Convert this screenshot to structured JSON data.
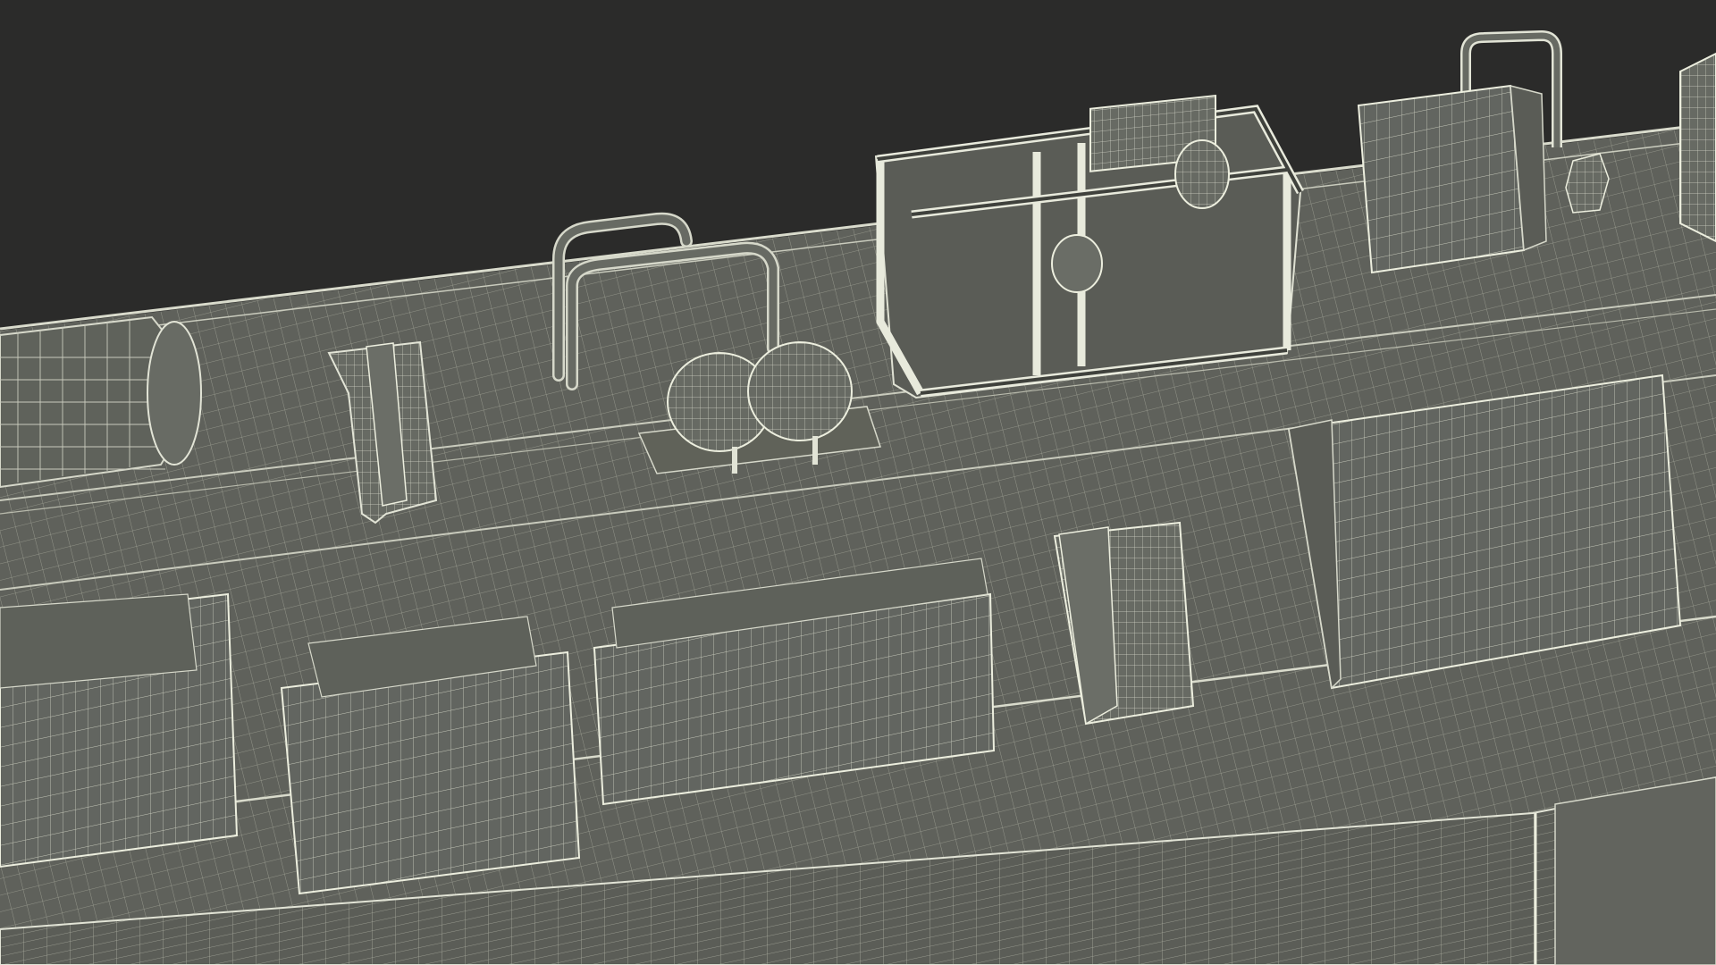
{
  "viewport": {
    "background_color": "#2b2b2a",
    "mesh_face_color": "#636560",
    "mesh_face_dark": "#55574f",
    "mesh_face_light": "#73756e",
    "wire_color": "#c9cbbd",
    "wire_highlight": "#f2f3e6"
  },
  "scene": {
    "subject": "wireframe-mesh-render",
    "objects": [
      {
        "kind": "cylindrical-tank",
        "name": "left-tank"
      },
      {
        "kind": "valve-box",
        "name": "small-valve-box"
      },
      {
        "kind": "pipe-railing",
        "name": "pipe-railing-left"
      },
      {
        "kind": "air-reservoirs",
        "name": "twin-air-reservoirs"
      },
      {
        "kind": "machinery-frame",
        "name": "compressor-frame"
      },
      {
        "kind": "control-cabinet",
        "name": "rear-control-cabinet"
      },
      {
        "kind": "battery-box",
        "name": "battery-box-left"
      },
      {
        "kind": "battery-box",
        "name": "battery-box-mid-left"
      },
      {
        "kind": "battery-box",
        "name": "battery-box-mid"
      },
      {
        "kind": "equipment-box",
        "name": "small-equipment-box"
      },
      {
        "kind": "battery-box",
        "name": "battery-box-right"
      },
      {
        "kind": "side-panel",
        "name": "riveted-side-panel"
      }
    ]
  }
}
